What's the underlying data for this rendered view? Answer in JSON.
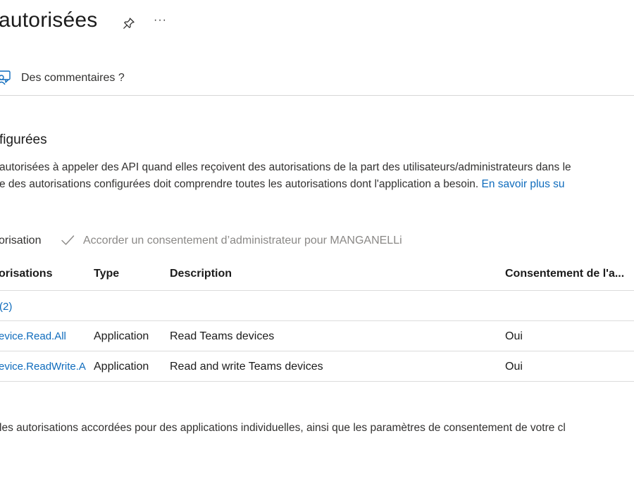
{
  "header": {
    "title": "autorisées",
    "pin_icon": "pin-icon",
    "more_label": "···"
  },
  "feedback": {
    "icon": "feedback-icon",
    "label": "Des commentaires ?"
  },
  "section": {
    "heading": "figurées",
    "paragraph_line1": "autorisées à appeler des API quand elles reçoivent des autorisations de la part des utilisateurs/administrateurs dans le",
    "paragraph_line2_text": "e des autorisations configurées doit comprendre toutes les autorisations dont l'application a besoin. ",
    "paragraph_line2_link": "En savoir plus su"
  },
  "commands": {
    "add_permission": "orisation",
    "grant_consent": "Accorder un consentement d’administrateur pour MANGANELLi",
    "check_icon": "checkmark-icon"
  },
  "table": {
    "headers": {
      "name": "orisations",
      "type": "Type",
      "description": "Description",
      "consent": "Consentement de l'a..."
    },
    "group_label": "(2)",
    "rows": [
      {
        "name": "evice.Read.All",
        "type": "Application",
        "description": "Read Teams devices",
        "consent": "Oui"
      },
      {
        "name": "evice.ReadWrite.A",
        "type": "Application",
        "description": "Read and write Teams devices",
        "consent": "Oui"
      }
    ]
  },
  "footer": {
    "text": " les autorisations accordées pour des applications individuelles, ainsi que les paramètres de consentement de votre cl"
  }
}
